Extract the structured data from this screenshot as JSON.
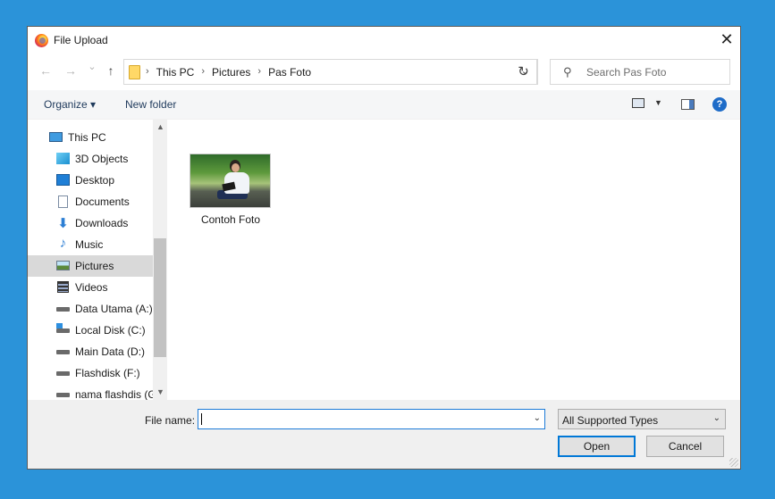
{
  "window": {
    "title": "File Upload",
    "close_glyph": "✕"
  },
  "nav": {
    "back_glyph": "←",
    "forward_glyph": "→",
    "recent_glyph": "⌄",
    "up_glyph": "↑",
    "breadcrumbs": [
      "This PC",
      "Pictures",
      "Pas Foto"
    ],
    "breadcrumb_sep": "›",
    "address_dropdown_glyph": "⌄",
    "refresh_glyph": "↻",
    "search_placeholder": "Search Pas Foto"
  },
  "toolbar": {
    "organize_label": "Organize ▾",
    "new_folder_label": "New folder",
    "help_glyph": "?"
  },
  "sidebar": {
    "items": [
      {
        "label": "This PC",
        "icon": "computer-icon"
      },
      {
        "label": "3D Objects",
        "icon": "cube-icon"
      },
      {
        "label": "Desktop",
        "icon": "desktop-icon"
      },
      {
        "label": "Documents",
        "icon": "document-icon"
      },
      {
        "label": "Downloads",
        "icon": "download-arrow-icon"
      },
      {
        "label": "Music",
        "icon": "music-note-icon"
      },
      {
        "label": "Pictures",
        "icon": "pictures-icon",
        "selected": true
      },
      {
        "label": "Videos",
        "icon": "film-icon"
      },
      {
        "label": "Data Utama (A:)",
        "icon": "drive-icon"
      },
      {
        "label": "Local Disk (C:)",
        "icon": "windows-drive-icon"
      },
      {
        "label": "Main Data (D:)",
        "icon": "drive-icon"
      },
      {
        "label": "Flashdisk (F:)",
        "icon": "drive-icon"
      },
      {
        "label": "nama flashdis (G",
        "icon": "drive-icon"
      }
    ],
    "scroll_up_glyph": "▲",
    "scroll_down_glyph": "▼"
  },
  "files": [
    {
      "name": "Contoh Foto",
      "thumbnail": "photo-of-person-reading"
    }
  ],
  "footer": {
    "file_name_label": "File name:",
    "file_name_value": "",
    "file_name_dropdown_glyph": "⌄",
    "file_type_selected": "All Supported Types",
    "file_type_dropdown_glyph": "⌄",
    "open_label": "Open",
    "cancel_label": "Cancel"
  },
  "colors": {
    "background": "#2b93d9",
    "selection": "#d9d9d9",
    "focus_border": "#0078d7",
    "help_blue": "#1e6cc8"
  }
}
